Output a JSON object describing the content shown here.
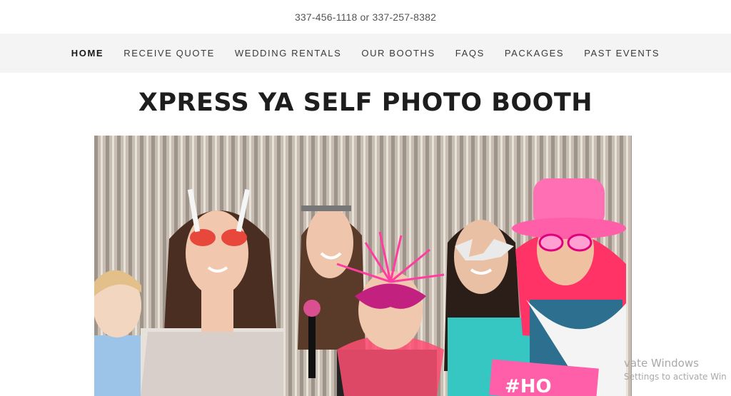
{
  "header": {
    "phone": "337-456-1118 or 337-257-8382"
  },
  "nav": {
    "items": [
      {
        "label": "HOME",
        "active": true
      },
      {
        "label": "RECEIVE QUOTE",
        "active": false
      },
      {
        "label": "WEDDING RENTALS",
        "active": false
      },
      {
        "label": "OUR BOOTHS",
        "active": false
      },
      {
        "label": "FAQS",
        "active": false
      },
      {
        "label": "PACKAGES",
        "active": false
      },
      {
        "label": "PAST EVENTS",
        "active": false
      }
    ]
  },
  "main": {
    "title": "XPRESS YA SELF PHOTO BOOTH",
    "hero_image": {
      "sign_text": "#HO"
    }
  },
  "watermark": {
    "line1": "vate Windows",
    "line2": "Settings to activate Win"
  },
  "colors": {
    "nav_bg": "#f4f4f4",
    "title": "#1e1e1e",
    "accent_pink": "#ff5fa8"
  }
}
